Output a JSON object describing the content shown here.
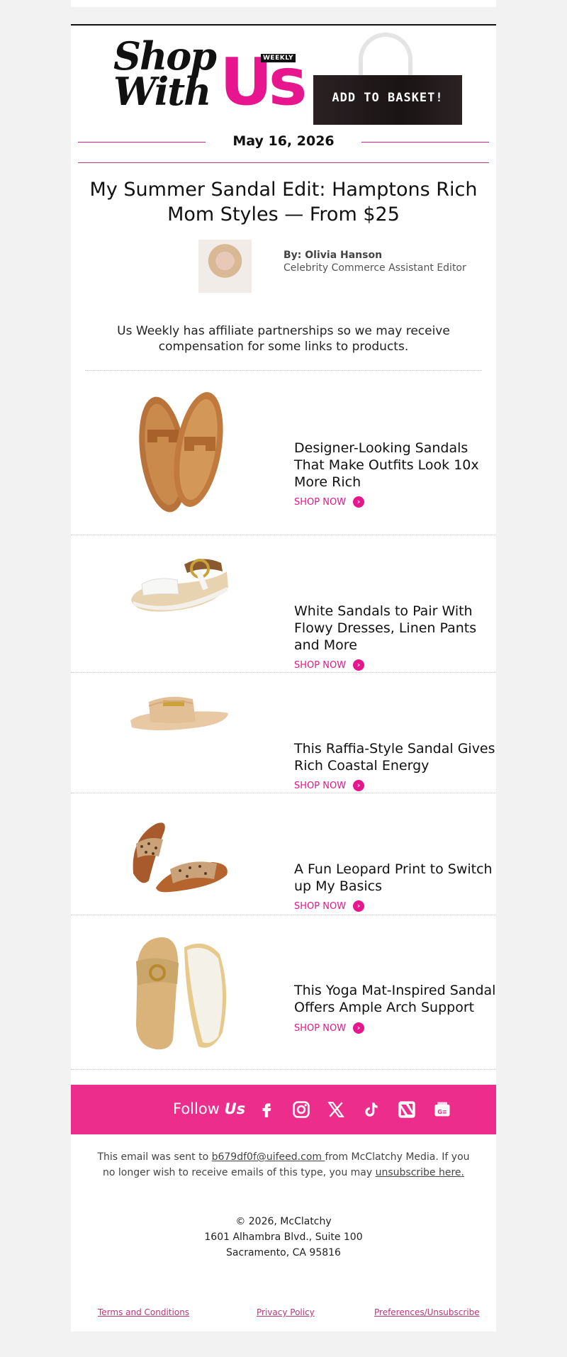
{
  "header": {
    "logo_shop_with": "Shop\nWith",
    "logo_us": "Us",
    "logo_weekly": "WEEKLY",
    "basket_label": "ADD TO BASKET!"
  },
  "date": "May 16, 2026",
  "article": {
    "headline": "My Summer Sandal Edit: Hamptons Rich Mom Styles — From $25",
    "author": "By: Olivia Hanson",
    "author_title": "Celebrity Commerce Assistant Editor",
    "disclaimer": "Us Weekly has affiliate partnerships so we may receive compensation for some links to products."
  },
  "items": [
    {
      "title": "Designer-Looking Sandals That Make Outfits Look 10x More Rich",
      "cta": "SHOP NOW"
    },
    {
      "title": "White Sandals to Pair With Flowy Dresses, Linen Pants and More",
      "cta": "SHOP NOW"
    },
    {
      "title": "This Raffia-Style Sandal Gives Rich Coastal Energy",
      "cta": "SHOP NOW"
    },
    {
      "title": "A Fun Leopard Print to Switch up My Basics",
      "cta": "SHOP NOW"
    },
    {
      "title": "This Yoga Mat-Inspired Sandal Offers Ample Arch Support",
      "cta": "SHOP NOW"
    }
  ],
  "follow": {
    "label": "Follow",
    "brand": "Us",
    "icons": [
      "facebook-icon",
      "instagram-icon",
      "x-icon",
      "tiktok-icon",
      "apple-news-icon",
      "google-news-icon"
    ]
  },
  "footer": {
    "sent_prefix": "This email was sent to ",
    "email": "b679df0f@uifeed.com ",
    "sent_middle": "from McClatchy Media. If you no longer wish to receive emails of this type, you may ",
    "unsubscribe": "unsubscribe here.",
    "copyright": "© 2026, McClatchy",
    "address1": "1601 Alhambra Blvd., Suite 100",
    "address2": "Sacramento, CA 95816",
    "links": [
      "Terms and Conditions",
      "Privacy Policy",
      "Preferences/Unsubscribe"
    ]
  },
  "colors": {
    "brand_pink": "#e8168e",
    "follow_bar": "#ec2d8c"
  }
}
